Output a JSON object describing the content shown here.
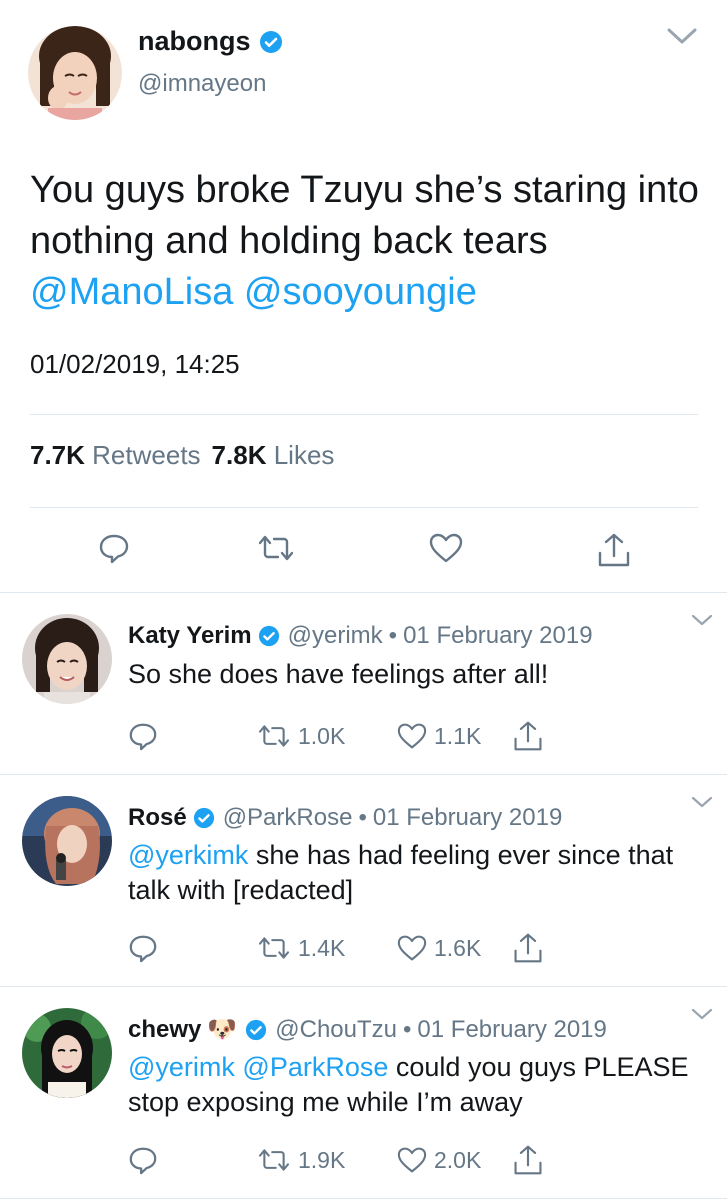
{
  "main_tweet": {
    "display_name": "nabongs",
    "handle": "@imnayeon",
    "text_plain": "You guys broke Tzuyu she’s staring into nothing and holding back tears",
    "mentions": [
      "@ManoLisa",
      "@sooyoungie"
    ],
    "timestamp": "01/02/2019, 14:25",
    "retweets_count": "7.7K",
    "retweets_label": "Retweets",
    "likes_count": "7.8K",
    "likes_label": "Likes"
  },
  "replies": [
    {
      "display_name": "Katy Yerim",
      "handle": "@yerimk",
      "separator": "•",
      "date": "01 February 2019",
      "text": "So she does have feelings after all!",
      "retweets": "1.0K",
      "likes": "1.1K"
    },
    {
      "display_name": "Rosé",
      "handle": "@ParkRose",
      "separator": "•",
      "date": "01 February 2019",
      "mention": "@yerkimk",
      "text": " she has had feeling ever since that talk with [redacted]",
      "retweets": "1.4K",
      "likes": "1.6K"
    },
    {
      "display_name": "chewy",
      "emoji": "🐶",
      "handle": "@ChouTzu",
      "separator": "•",
      "date": "01 February 2019",
      "mention1": "@yerimk",
      "mention2": "@ParkRose",
      "text": " could you guys PLEASE stop exposing me while I’m away",
      "retweets": "1.9K",
      "likes": "2.0K"
    }
  ],
  "icons": {
    "verified": "verified-badge-icon",
    "reply": "reply-bubble-icon",
    "retweet": "retweet-icon",
    "like": "heart-icon",
    "share": "share-icon",
    "caret": "chevron-down-icon"
  },
  "colors": {
    "link": "#1da1f2",
    "text": "#14171a",
    "muted": "#657786",
    "divider": "#e1e8ed"
  }
}
